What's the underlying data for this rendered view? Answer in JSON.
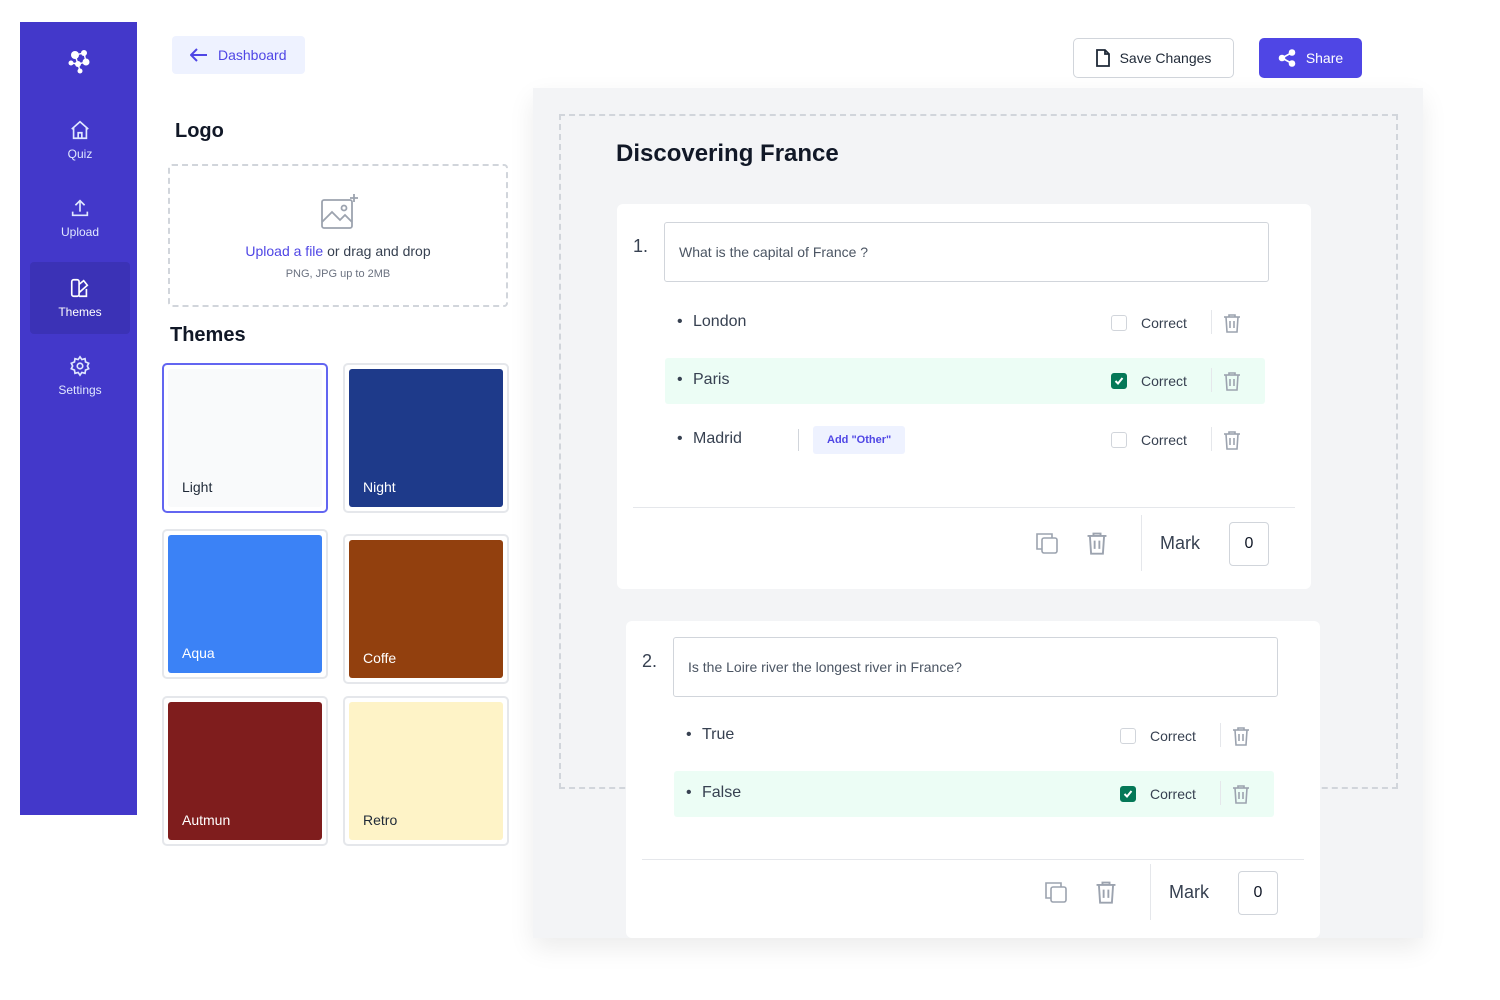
{
  "sidebar": {
    "items": [
      {
        "label": "Quiz",
        "icon": "home-icon"
      },
      {
        "label": "Upload",
        "icon": "upload-icon"
      },
      {
        "label": "Themes",
        "icon": "themes-icon",
        "active": true
      },
      {
        "label": "Settings",
        "icon": "gear-icon"
      }
    ]
  },
  "toolbar": {
    "back_label": "Dashboard",
    "save_label": "Save Changes",
    "share_label": "Share"
  },
  "logo_section": {
    "title": "Logo",
    "upload_link": "Upload a file",
    "upload_rest": " or drag and drop",
    "hint": "PNG, JPG up to 2MB"
  },
  "themes": {
    "title": "Themes",
    "items": [
      {
        "label": "Light",
        "color": "#f9fafb",
        "text_color": "#1f2937",
        "selected": true
      },
      {
        "label": "Night",
        "color": "#1e3a8a",
        "text_color": "#ffffff"
      },
      {
        "label": "Aqua",
        "color": "#3b82f6",
        "text_color": "#ffffff"
      },
      {
        "label": "Coffe",
        "color": "#92400e",
        "text_color": "#ffffff"
      },
      {
        "label": "Autmun",
        "color": "#7f1d1d",
        "text_color": "#ffffff"
      },
      {
        "label": "Retro",
        "color": "#fef3c7",
        "text_color": "#1f2937"
      }
    ]
  },
  "quiz": {
    "title": "Discovering France",
    "questions": [
      {
        "number": "1.",
        "text": "What is the capital of France ?",
        "answers": [
          {
            "text": "London",
            "correct": false,
            "correct_label": "Correct"
          },
          {
            "text": "Paris",
            "correct": true,
            "correct_label": "Correct"
          },
          {
            "text": "Madrid",
            "correct": false,
            "correct_label": "Correct",
            "add_other_label": "Add \"Other\""
          }
        ],
        "mark_label": "Mark",
        "mark_value": "0"
      },
      {
        "number": "2.",
        "text": "Is the Loire river the longest river in France?",
        "answers": [
          {
            "text": "True",
            "correct": false,
            "correct_label": "Correct"
          },
          {
            "text": "False",
            "correct": true,
            "correct_label": "Correct"
          }
        ],
        "mark_label": "Mark",
        "mark_value": "0"
      }
    ]
  },
  "colors": {
    "brand": "#4338ca",
    "accent": "#4f46e5",
    "correct": "#047857"
  }
}
